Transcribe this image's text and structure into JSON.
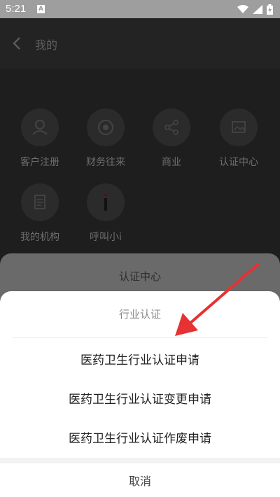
{
  "status_bar": {
    "time": "5:21",
    "notif_letter": "A"
  },
  "header": {
    "title": "我的"
  },
  "grid": [
    {
      "label": "客户注册",
      "icon": "person-icon"
    },
    {
      "label": "财务往来",
      "icon": "finance-icon"
    },
    {
      "label": "商业",
      "icon": "share-icon"
    },
    {
      "label": "认证中心",
      "icon": "image-icon"
    },
    {
      "label": "我的机构",
      "icon": "document-icon"
    },
    {
      "label": "呼叫小i",
      "icon": "info-i-icon"
    }
  ],
  "sheet_back": {
    "title": "认证中心"
  },
  "sheet": {
    "header": "行业认证",
    "options": [
      "医药卫生行业认证申请",
      "医药卫生行业认证变更申请",
      "医药卫生行业认证作废申请"
    ],
    "cancel": "取消"
  },
  "colors": {
    "arrow": "#e63232"
  }
}
